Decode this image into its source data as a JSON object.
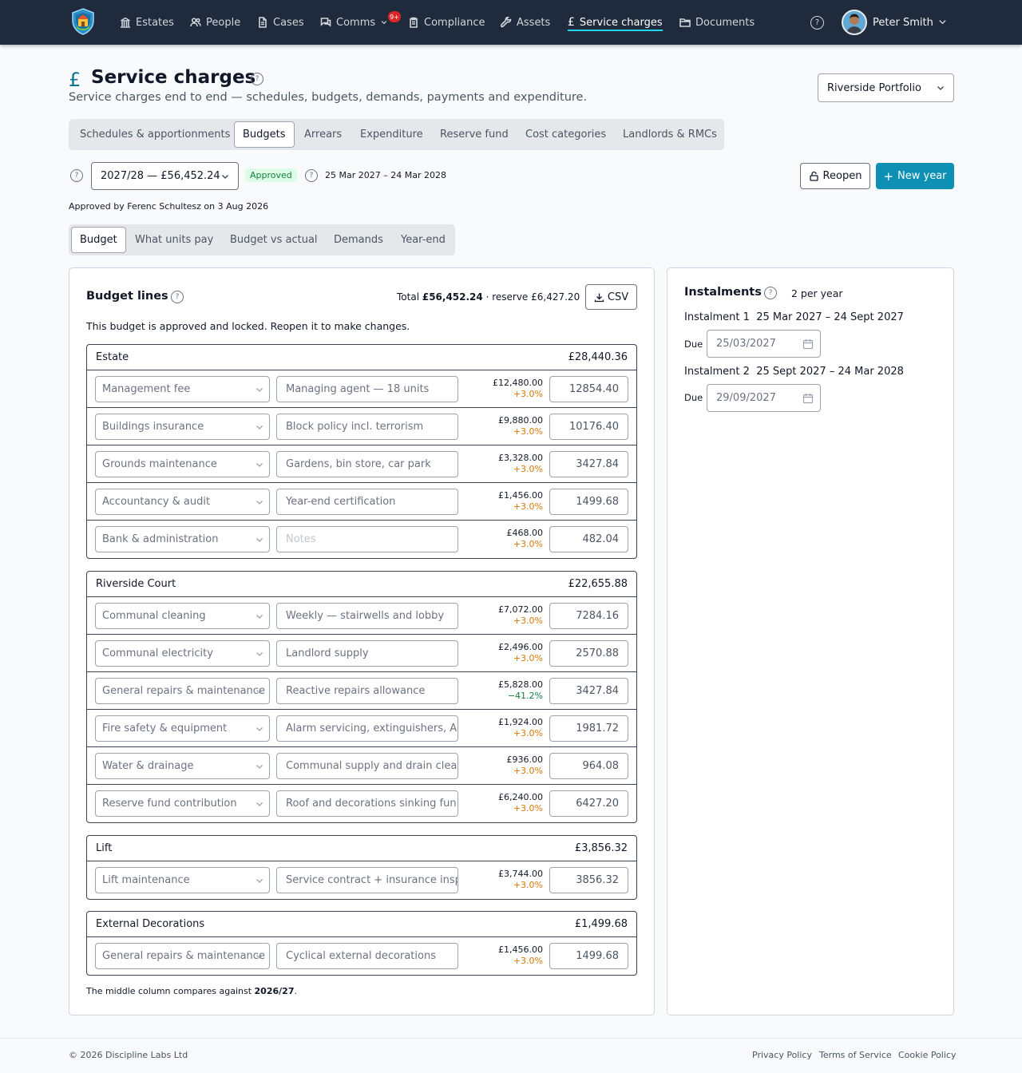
{
  "nav": {
    "items": [
      {
        "label": "Estates",
        "icon": "building-icon"
      },
      {
        "label": "People",
        "icon": "people-icon"
      },
      {
        "label": "Cases",
        "icon": "document-icon"
      },
      {
        "label": "Comms",
        "icon": "chat-icon"
      },
      {
        "label": "Compliance",
        "icon": "clipboard-icon"
      },
      {
        "label": "Assets",
        "icon": "wrench-icon"
      },
      {
        "label": "Service charges",
        "icon": "pound-icon"
      },
      {
        "label": "Documents",
        "icon": "folder-icon"
      }
    ],
    "comms_badge": "9+",
    "active": "Service charges",
    "user_name": "Peter Smith"
  },
  "header": {
    "icon": "£",
    "title": "Service charges",
    "subtitle": "Service charges end to end — schedules, budgets, demands, payments and expenditure.",
    "portfolio": "Riverside Portfolio"
  },
  "tabs": [
    "Schedules & apportionments",
    "Budgets",
    "Arrears",
    "Expenditure",
    "Reserve fund",
    "Cost categories",
    "Landlords & RMCs"
  ],
  "active_tab": "Budgets",
  "budget": {
    "year": "2027/28 — £56,452.24",
    "status": "Approved",
    "period": "25 Mar 2027 – 24 Mar 2028",
    "approved_by": "Approved by Ferenc Schultesz on 3 Aug 2026",
    "reopen_label": "Reopen",
    "new_year_label": "New year"
  },
  "subtabs": [
    "Budget",
    "What units pay",
    "Budget vs actual",
    "Demands",
    "Year-end"
  ],
  "active_subtab": "Budget",
  "lines_panel": {
    "title": "Budget lines",
    "total_prefix": "Total ",
    "total_value": "£56,452.24",
    "reserve_text": " · reserve £6,427.20",
    "csv_label": "CSV",
    "locked_message": "This budget is approved and locked. Reopen it to make changes.",
    "groups": [
      {
        "name": "Estate",
        "total": "£28,440.36",
        "lines": [
          {
            "category": "Management fee",
            "note": "Managing agent — 18 units",
            "note_placeholder": false,
            "prev": "£12,480.00",
            "change": "+3.0%",
            "amount": "12854.40"
          },
          {
            "category": "Buildings insurance",
            "note": "Block policy incl. terrorism",
            "note_placeholder": false,
            "prev": "£9,880.00",
            "change": "+3.0%",
            "amount": "10176.40"
          },
          {
            "category": "Grounds maintenance",
            "note": "Gardens, bin store, car park",
            "note_placeholder": false,
            "prev": "£3,328.00",
            "change": "+3.0%",
            "amount": "3427.84"
          },
          {
            "category": "Accountancy & audit",
            "note": "Year-end certification",
            "note_placeholder": false,
            "prev": "£1,456.00",
            "change": "+3.0%",
            "amount": "1499.68"
          },
          {
            "category": "Bank & administration",
            "note": "Notes",
            "note_placeholder": true,
            "prev": "£468.00",
            "change": "+3.0%",
            "amount": "482.04"
          }
        ]
      },
      {
        "name": "Riverside Court",
        "total": "£22,655.88",
        "lines": [
          {
            "category": "Communal cleaning",
            "note": "Weekly — stairwells and lobby",
            "note_placeholder": false,
            "prev": "£7,072.00",
            "change": "+3.0%",
            "amount": "7284.16"
          },
          {
            "category": "Communal electricity",
            "note": "Landlord supply",
            "note_placeholder": false,
            "prev": "£2,496.00",
            "change": "+3.0%",
            "amount": "2570.88"
          },
          {
            "category": "General repairs & maintenance",
            "note": "Reactive repairs allowance",
            "note_placeholder": false,
            "prev": "£5,828.00",
            "change": "−41.2%",
            "amount": "3427.84"
          },
          {
            "category": "Fire safety & equipment",
            "note": "Alarm servicing, extinguishers, A",
            "note_placeholder": false,
            "prev": "£1,924.00",
            "change": "+3.0%",
            "amount": "1981.72"
          },
          {
            "category": "Water & drainage",
            "note": "Communal supply and drain clea",
            "note_placeholder": false,
            "prev": "£936.00",
            "change": "+3.0%",
            "amount": "964.08"
          },
          {
            "category": "Reserve fund contribution",
            "note": "Roof and decorations sinking fun",
            "note_placeholder": false,
            "prev": "£6,240.00",
            "change": "+3.0%",
            "amount": "6427.20"
          }
        ]
      },
      {
        "name": "Lift",
        "total": "£3,856.32",
        "lines": [
          {
            "category": "Lift maintenance",
            "note": "Service contract + insurance insp",
            "note_placeholder": false,
            "prev": "£3,744.00",
            "change": "+3.0%",
            "amount": "3856.32"
          }
        ]
      },
      {
        "name": "External Decorations",
        "total": "£1,499.68",
        "lines": [
          {
            "category": "General repairs & maintenance",
            "note": "Cyclical external decorations",
            "note_placeholder": false,
            "prev": "£1,456.00",
            "change": "+3.0%",
            "amount": "1499.68"
          }
        ]
      }
    ],
    "footnote_prefix": "The middle column compares against ",
    "footnote_year": "2026/27",
    "footnote_suffix": "."
  },
  "instalments": {
    "title": "Instalments",
    "count": "2 per year",
    "due_label": "Due",
    "items": [
      {
        "label": "Instalment 1",
        "period": "25 Mar 2027 – 24 Sept 2027",
        "due": "25/03/2027"
      },
      {
        "label": "Instalment 2",
        "period": "25 Sept 2027 – 24 Mar 2028",
        "due": "29/09/2027"
      }
    ]
  },
  "footer": {
    "copyright": "© 2026 Discipline Labs Ltd",
    "links": [
      "Privacy Policy",
      "Terms of Service",
      "Cookie Policy"
    ]
  },
  "colors": {
    "nav_bg": "#1f2a3c",
    "accent": "#0e90b5",
    "active_underline": "#22d3ee",
    "increase": "#d97706",
    "decrease": "#15803d"
  }
}
